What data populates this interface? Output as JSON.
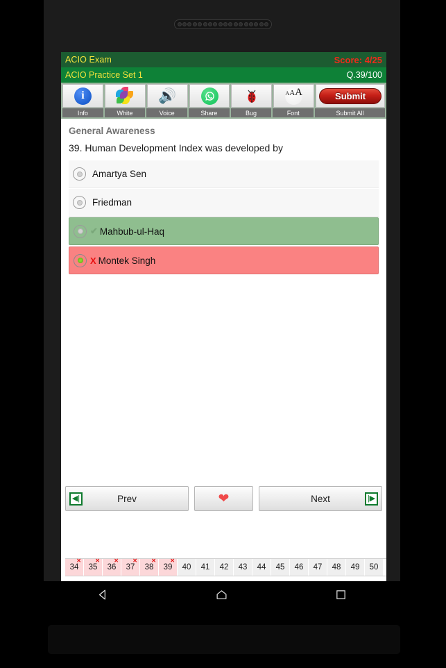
{
  "device": {
    "speaker_dots": 18
  },
  "header": {
    "app_title": "ACIO Exam",
    "score": "Score: 4/25",
    "set_name": "ACIO Practice Set 1",
    "question_counter": "Q.39/100",
    "title_color": "#f2e23c",
    "score_color": "#ee2b1b",
    "bar_color": "#0e8137"
  },
  "toolbar": {
    "items": [
      {
        "icon": "info-icon",
        "label": "Info"
      },
      {
        "icon": "pinwheel-icon",
        "label": "White"
      },
      {
        "icon": "speaker-icon",
        "label": "Voice"
      },
      {
        "icon": "whatsapp-share-icon",
        "label": "Share"
      },
      {
        "icon": "ladybug-icon",
        "label": "Bug"
      },
      {
        "icon": "font-size-icon",
        "label": "Font"
      }
    ],
    "submit_label": "Submit",
    "submit_caption": "Submit All"
  },
  "question": {
    "subject": "General Awareness",
    "text": "39. Human Development Index was developed by",
    "options": [
      {
        "label": "Amartya Sen",
        "state": "plain",
        "selected": false,
        "mark": ""
      },
      {
        "label": "Friedman",
        "state": "plain",
        "selected": false,
        "mark": ""
      },
      {
        "label": "Mahbub-ul-Haq",
        "state": "correct",
        "selected": false,
        "mark": "✔"
      },
      {
        "label": "Montek Singh",
        "state": "wrong",
        "selected": true,
        "mark": "X"
      }
    ],
    "correct_color": "#8fbe8f",
    "wrong_color": "#fa8282"
  },
  "nav": {
    "prev_label": "Prev",
    "next_label": "Next",
    "favorite_icon": "heart-icon",
    "prev_icon": "skip-first-icon",
    "next_icon": "skip-last-icon"
  },
  "number_strip": {
    "cells": [
      {
        "n": "34",
        "attempted": true,
        "mark": "✕"
      },
      {
        "n": "35",
        "attempted": true,
        "mark": "✕"
      },
      {
        "n": "36",
        "attempted": true,
        "mark": "✕"
      },
      {
        "n": "37",
        "attempted": true,
        "mark": "✕"
      },
      {
        "n": "38",
        "attempted": true,
        "mark": "✕"
      },
      {
        "n": "39",
        "attempted": true,
        "mark": "✕"
      },
      {
        "n": "40",
        "attempted": false,
        "mark": ""
      },
      {
        "n": "41",
        "attempted": false,
        "mark": ""
      },
      {
        "n": "42",
        "attempted": false,
        "mark": ""
      },
      {
        "n": "43",
        "attempted": false,
        "mark": ""
      },
      {
        "n": "44",
        "attempted": false,
        "mark": ""
      },
      {
        "n": "45",
        "attempted": false,
        "mark": ""
      },
      {
        "n": "46",
        "attempted": false,
        "mark": ""
      },
      {
        "n": "47",
        "attempted": false,
        "mark": ""
      },
      {
        "n": "48",
        "attempted": false,
        "mark": ""
      },
      {
        "n": "49",
        "attempted": false,
        "mark": ""
      },
      {
        "n": "50",
        "attempted": false,
        "mark": ""
      }
    ]
  },
  "android_nav": {
    "back": "back-triangle-icon",
    "home": "home-pentagon-icon",
    "recents": "recents-square-icon"
  }
}
